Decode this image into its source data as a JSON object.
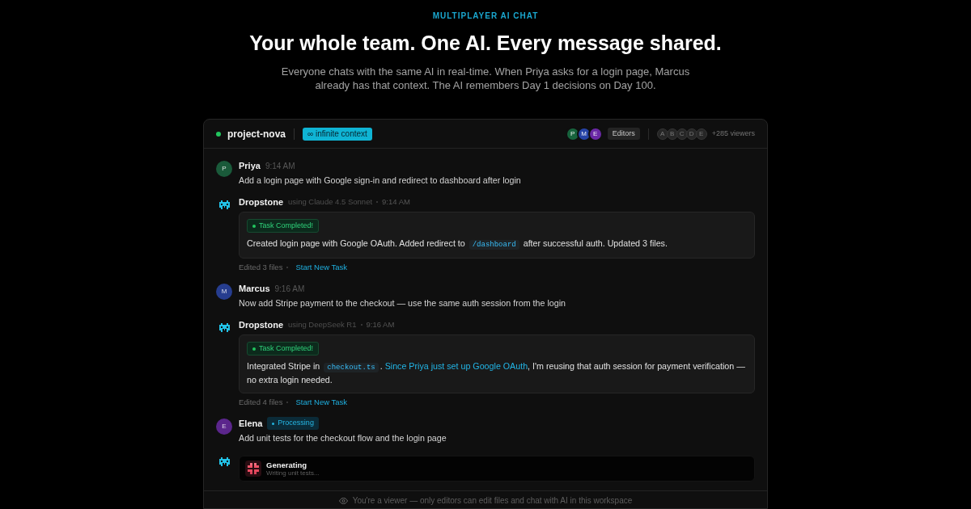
{
  "hero": {
    "eyebrow": "MULTIPLAYER AI CHAT",
    "title": "Your whole team. One AI. Every message shared.",
    "subtitle": "Everyone chats with the same AI in real-time. When Priya asks for a login page, Marcus already has that context. The AI remembers Day 1 decisions on Day 100."
  },
  "chat": {
    "channel": "project-nova",
    "context_badge": {
      "symbol": "∞",
      "label": "infinite context"
    },
    "editors": [
      {
        "initial": "P",
        "color": "#17633d"
      },
      {
        "initial": "M",
        "color": "#2643a6"
      },
      {
        "initial": "E",
        "color": "#6a28a6"
      }
    ],
    "editors_label": "Editors",
    "viewers": [
      "A",
      "B",
      "C",
      "D",
      "E"
    ],
    "viewer_count": "+285 viewers",
    "messages": [
      {
        "kind": "user",
        "author": "Priya",
        "initial": "P",
        "color": "#1a5a3a",
        "time": "9:14 AM",
        "text": "Add a login page with Google sign-in and redirect to dashboard after login"
      },
      {
        "kind": "ai",
        "author": "Dropstone",
        "model": "using Claude 4.5 Sonnet",
        "time": "9:14 AM",
        "status": "Task Completed!",
        "parts": [
          {
            "kind": "text",
            "text": "Created login page with Google OAuth. Added redirect to "
          },
          {
            "kind": "code",
            "text": "/dashboard"
          },
          {
            "kind": "text",
            "text": " after successful auth. Updated 3 files."
          }
        ],
        "summary": "Edited 3 files",
        "action": "Start New Task"
      },
      {
        "kind": "user",
        "author": "Marcus",
        "initial": "M",
        "color": "#263d8f",
        "time": "9:16 AM",
        "text": "Now add Stripe payment to the checkout — use the same auth session from the login"
      },
      {
        "kind": "ai",
        "author": "Dropstone",
        "model": "using DeepSeek R1",
        "time": "9:16 AM",
        "status": "Task Completed!",
        "parts": [
          {
            "kind": "text",
            "text": "Integrated Stripe in "
          },
          {
            "kind": "code",
            "text": "checkout.ts"
          },
          {
            "kind": "text",
            "text": ". "
          },
          {
            "kind": "link",
            "text": "Since Priya just set up Google OAuth"
          },
          {
            "kind": "text",
            "text": ", I'm reusing that auth session for payment verification — no extra login needed."
          }
        ],
        "summary": "Edited 4 files",
        "action": "Start New Task"
      },
      {
        "kind": "user",
        "author": "Elena",
        "initial": "E",
        "color": "#5b268c",
        "status": "Processing",
        "text": "Add unit tests for the checkout flow and the login page"
      },
      {
        "kind": "generating",
        "title": "Generating",
        "detail": "Writing unit tests..."
      }
    ],
    "notice": "You're a viewer — only editors can edit files and chat with AI in this workspace"
  }
}
